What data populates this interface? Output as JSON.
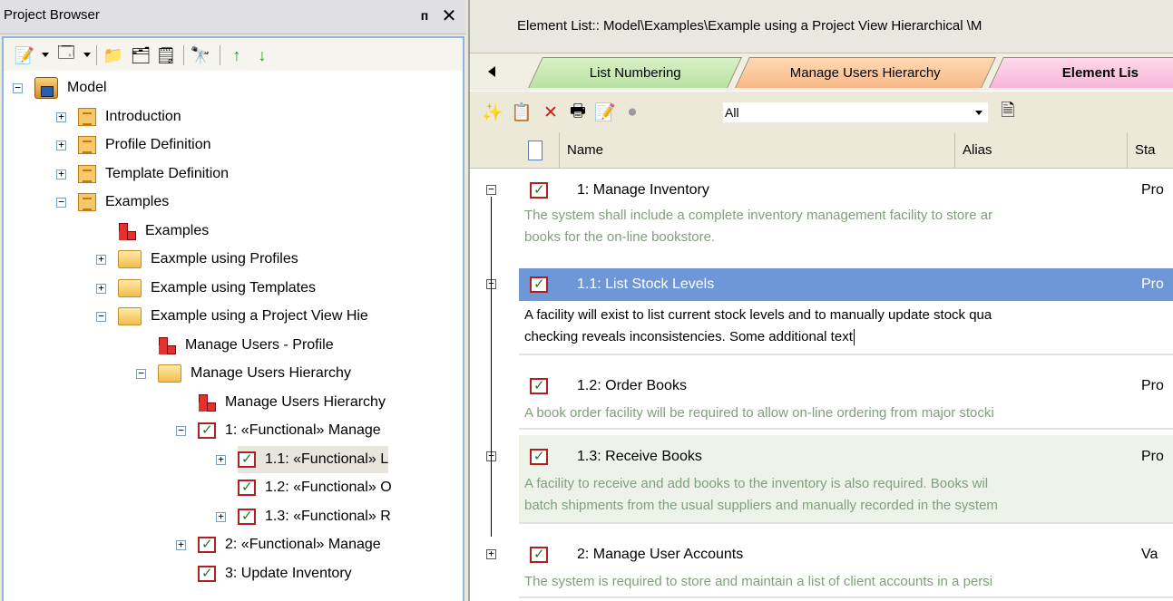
{
  "project_browser": {
    "title": "Project Browser",
    "pin_icon": "pin-icon",
    "close_icon": "close-icon",
    "toolbar_icons": [
      "new-element-icon",
      "new-diagram-icon",
      "new-package-icon",
      "new-view-icon",
      "element-properties-icon",
      "find-icon",
      "move-up-icon",
      "move-down-icon"
    ],
    "tree": [
      {
        "label": "Model",
        "icon": "model-icon",
        "level": 0,
        "expander": "−"
      },
      {
        "label": "Introduction",
        "icon": "package-icon",
        "level": 1,
        "expander": "+"
      },
      {
        "label": "Profile Definition",
        "icon": "package-icon",
        "level": 1,
        "expander": "+"
      },
      {
        "label": "Template Definition",
        "icon": "package-icon",
        "level": 1,
        "expander": "+"
      },
      {
        "label": "Examples",
        "icon": "package-icon",
        "level": 1,
        "expander": "−"
      },
      {
        "label": "Examples",
        "icon": "diagram-icon",
        "level": 2,
        "expander": ""
      },
      {
        "label": "Eaxmple using Profiles",
        "icon": "folder-icon",
        "level": 2,
        "expander": "+"
      },
      {
        "label": "Example using Templates",
        "icon": "folder-icon",
        "level": 2,
        "expander": "+"
      },
      {
        "label": "Example using a Project View  Hie",
        "icon": "folder-icon",
        "level": 2,
        "expander": "−"
      },
      {
        "label": "Manage Users - Profile",
        "icon": "diagram-icon",
        "level": 3,
        "expander": ""
      },
      {
        "label": "Manage Users Hierarchy",
        "icon": "folder-icon",
        "level": 3,
        "expander": "−"
      },
      {
        "label": "Manage Users Hierarchy",
        "icon": "diagram-icon",
        "level": 4,
        "expander": ""
      },
      {
        "label": "1: «Functional» Manage",
        "icon": "requirement-icon",
        "level": 4,
        "expander": "−"
      },
      {
        "label": "1.1: «Functional» L",
        "icon": "requirement-icon",
        "level": 5,
        "expander": "+"
      },
      {
        "label": "1.2: «Functional» O",
        "icon": "requirement-icon",
        "level": 5,
        "expander": ""
      },
      {
        "label": "1.3: «Functional» R",
        "icon": "requirement-icon",
        "level": 5,
        "expander": "+"
      },
      {
        "label": "2: «Functional» Manage",
        "icon": "requirement-icon",
        "level": 4,
        "expander": "+"
      },
      {
        "label": "3: Update Inventory",
        "icon": "requirement-icon",
        "level": 4,
        "expander": ""
      }
    ]
  },
  "element_list": {
    "header": "Element List:: Model\\Examples\\Example using a Project View  Hierarchical \\M",
    "tabs": [
      "List Numbering",
      "Manage Users Hierarchy",
      "Element Lis"
    ],
    "filter_value": "All",
    "columns": [
      "Name",
      "Alias",
      "Sta"
    ],
    "rows": [
      {
        "name": "1: Manage Inventory",
        "status": "Pro",
        "notes": [
          "The system shall include a complete inventory management facility to store ar",
          "books for the on-line bookstore."
        ],
        "expander": "−"
      },
      {
        "name": "1.1: List Stock Levels",
        "status": "Pro",
        "notes": [
          "A facility will exist to list current stock levels and to manually update stock qua",
          "checking reveals inconsistencies. Some additional text"
        ],
        "expander": "+",
        "selected": true
      },
      {
        "name": "1.2: Order Books",
        "status": "Pro",
        "notes": [
          "A book order facility will be required to allow on-line ordering from major stocki"
        ],
        "expander": ""
      },
      {
        "name": "1.3: Receive Books",
        "status": "Pro",
        "notes": [
          "A facility to receive and add books to the inventory is also required. Books wil",
          "batch shipments from the usual suppliers and manually recorded in the system"
        ],
        "expander": "+"
      },
      {
        "name": "2: Manage User Accounts",
        "status": "Va",
        "notes": [
          "The system is required to store and maintain a list of client accounts in a persi"
        ],
        "expander": "+"
      }
    ]
  }
}
